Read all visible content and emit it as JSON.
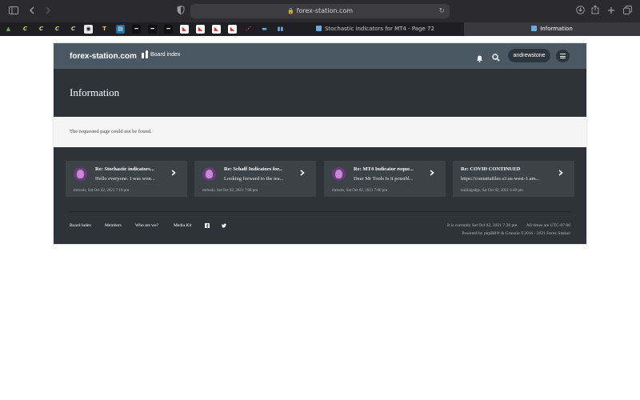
{
  "browser": {
    "url": "forex-station.com",
    "tabs": [
      {
        "label": "Stochastic indicators for MT4 - Page 72",
        "active": false
      },
      {
        "label": "Information",
        "active": true
      }
    ],
    "icons": [
      "sidebar-toggle-icon",
      "back-icon",
      "forward-icon",
      "privacy-shield-icon",
      "lock-icon",
      "reload-icon",
      "download-icon",
      "share-icon",
      "new-tab-icon",
      "tab-overview-icon"
    ]
  },
  "bookmarks": [
    "tree",
    "C",
    "C",
    "C",
    "C",
    "camera",
    "T",
    "chart",
    "bars",
    "bars",
    "bars",
    "chart-red",
    "chart-red",
    "chart-red",
    "chart-red",
    "scatter",
    "chat",
    "tabs"
  ],
  "site": {
    "logo": "forex-station.com",
    "nav_board_index": "Board index",
    "username": "andrewstone",
    "page_title": "Information",
    "message": "The requested page could not be found."
  },
  "recent_posts": [
    {
      "title": "Re: Stochastic indicators...",
      "excerpt": "Hello everyone. I was won...",
      "meta": "mrtools, Sat Oct 02, 2021 7:16 pm",
      "avatar": true
    },
    {
      "title": "Re: Schaff Indicators for...",
      "excerpt": "Looking forward to the tea...",
      "meta": "mrtools, Sat Oct 02, 2021 7:08 pm",
      "avatar": true
    },
    {
      "title": "Re: MT4 Indicator reque...",
      "excerpt": "Dear Mr Tools Is it possibl...",
      "meta": "mrtools, Sat Oct 02, 2021 7:06 pm",
      "avatar": true
    },
    {
      "title": "Re: COVID CONTINUED",
      "excerpt": "https://contattafiles.s3.us-west-1.am...",
      "meta": "trailingedge, Sat Oct 02, 2021 6:40 pm",
      "avatar": false
    }
  ],
  "footer": {
    "links": [
      "Board index",
      "Members",
      "Who are we?",
      "Media Kit"
    ],
    "social": [
      "facebook-icon",
      "twitter-icon"
    ],
    "current_time": "It is currently Sat Oct 02, 2021 7:26 pm",
    "timezone": "All times are UTC-07:00",
    "powered": "Powered by phpBB® & Grunzio ©2016 - 2021 Forex Station"
  },
  "colors": {
    "nav_bg": "#4a5863",
    "page_bg": "#2d3338",
    "card_bg": "#3b4248",
    "message_bg": "#f5f5f5",
    "chrome_bg": "#2b2a2e"
  }
}
